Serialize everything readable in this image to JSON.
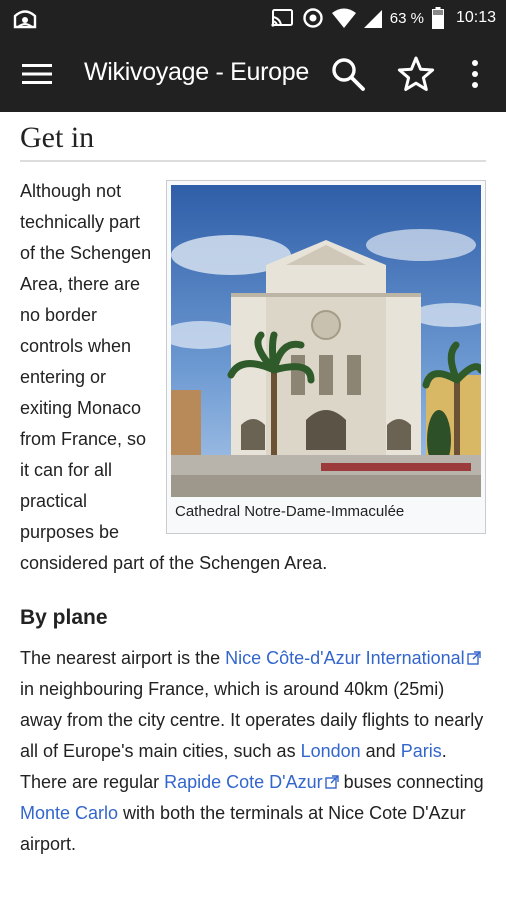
{
  "status_bar": {
    "battery_percent": "63 %",
    "time": "10:13"
  },
  "app_bar": {
    "title": "Wikivoyage - Europe"
  },
  "article": {
    "heading": "Get in",
    "intro_paragraph": "Although not technically part of the Schengen Area, there are no border controls when entering or exiting Monaco from France, so it can for all practical purposes be considered part of the Schengen Area.",
    "figure_caption": "Cathedral Notre-Dame-Immaculée",
    "subheading": "By plane",
    "plane_paragraph": {
      "t1": "The nearest airport is the ",
      "link_airport": "Nice Côte-d'Azur International",
      "t2": " in neighbouring France, which is around 40km (25mi) away from the city centre. It operates daily flights to nearly all of Europe's main cities, such as ",
      "link_london": "London",
      "t3": " and ",
      "link_paris": "Paris",
      "t4": ". There are regular ",
      "link_rapide": "Rapide Cote D'Azur",
      "t5": " buses connecting ",
      "link_montecarlo": "Monte Carlo",
      "t6": " with both the terminals at Nice Cote D'Azur airport."
    }
  },
  "colors": {
    "bar_background": "#212121",
    "link": "#3366cc",
    "text": "#222222"
  },
  "icons": [
    "app-notification-icon",
    "cast-icon",
    "data-saver-icon",
    "wifi-icon",
    "cell-signal-icon",
    "battery-icon",
    "menu-icon",
    "search-icon",
    "star-icon",
    "more-vert-icon",
    "external-link-icon"
  ]
}
